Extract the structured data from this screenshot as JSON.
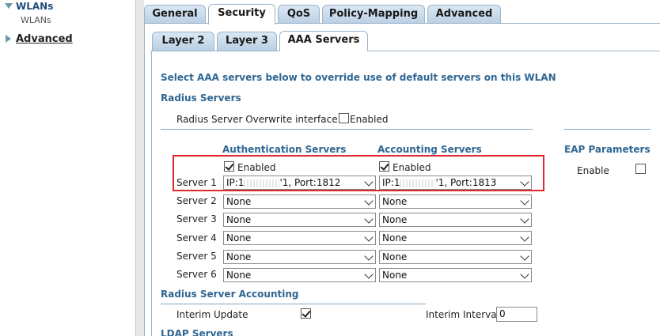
{
  "sidebar": {
    "wlans": "WLANs",
    "wlans_sub": "WLANs",
    "advanced": "Advanced"
  },
  "tabs": [
    {
      "label": "General"
    },
    {
      "label": "Security"
    },
    {
      "label": "QoS"
    },
    {
      "label": "Policy-Mapping"
    },
    {
      "label": "Advanced"
    }
  ],
  "subtabs": [
    {
      "label": "Layer 2"
    },
    {
      "label": "Layer 3"
    },
    {
      "label": "AAA Servers"
    }
  ],
  "content": {
    "intro": "Select AAA servers below to override use of default servers on this WLAN",
    "radius_heading": "Radius Servers",
    "overwrite_label": "Radius Server Overwrite interface",
    "overwrite_enabled": "Enabled",
    "auth_heading": "Authentication Servers",
    "acct_heading": "Accounting Servers",
    "auth_enabled": "Enabled",
    "acct_enabled": "Enabled",
    "eap_heading": "EAP Parameters",
    "eap_enable": "Enable",
    "servers": [
      {
        "label": "Server 1",
        "auth_pre": "IP:1",
        "auth_post": "'1, Port:1812",
        "acct_pre": "IP:1",
        "acct_post": "'1, Port:1813"
      },
      {
        "label": "Server 2",
        "auth": "None",
        "acct": "None"
      },
      {
        "label": "Server 3",
        "auth": "None",
        "acct": "None"
      },
      {
        "label": "Server 4",
        "auth": "None",
        "acct": "None"
      },
      {
        "label": "Server 5",
        "auth": "None",
        "acct": "None"
      },
      {
        "label": "Server 6",
        "auth": "None",
        "acct": "None"
      }
    ],
    "accounting_heading": "Radius Server Accounting",
    "interim_update": "Interim Update",
    "interim_interval": "Interim Interval",
    "interim_interval_value": "0",
    "ldap_heading": "LDAP Servers"
  },
  "colors": {
    "accent_heading": "#2f6692",
    "highlight_border": "#e0282e",
    "tab_border": "#9cb3c8"
  }
}
